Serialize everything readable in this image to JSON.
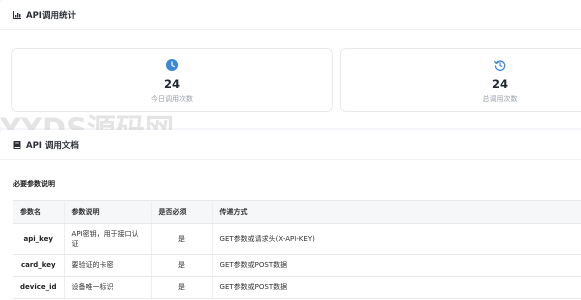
{
  "stats_card": {
    "title": "API调用统计",
    "icon": "bar-chart-icon",
    "stats": [
      {
        "icon": "clock-icon",
        "value": "24",
        "label": "今日调用次数"
      },
      {
        "icon": "history-icon",
        "value": "24",
        "label": "总调用次数"
      }
    ]
  },
  "doc_card": {
    "title": "API 调用文档",
    "icon": "book-icon",
    "section_label": "必要参数说明",
    "table": {
      "headers": [
        "参数名",
        "参数说明",
        "是否必须",
        "传递方式"
      ],
      "rows": [
        {
          "name": "api_key",
          "desc": "API密钥，用于接口认证",
          "required": "是",
          "method": "GET参数或请求头(X-API-KEY)"
        },
        {
          "name": "card_key",
          "desc": "要验证的卡密",
          "required": "是",
          "method": "GET参数或POST数据"
        },
        {
          "name": "device_id",
          "desc": "设备唯一标识",
          "required": "是",
          "method": "GET参数或POST数据"
        }
      ]
    }
  },
  "watermark": "YYDS源码网",
  "colors": {
    "accent": "#3a87d8",
    "title": "#2b2f36",
    "muted": "#9aa1ab"
  }
}
